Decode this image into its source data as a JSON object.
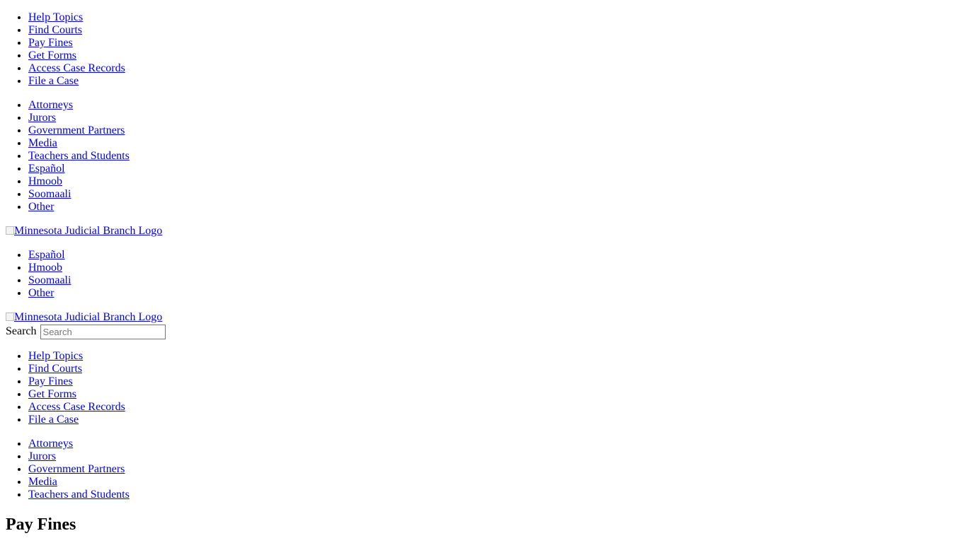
{
  "top_nav": {
    "items": [
      "Help Topics",
      "Find Courts",
      "Pay Fines",
      "Get Forms",
      "Access Case Records",
      "File a Case"
    ]
  },
  "audience_nav": {
    "items": [
      "Attorneys",
      "Jurors",
      "Government Partners",
      "Media",
      "Teachers and Students",
      "Español",
      "Hmoob",
      "Soomaali",
      "Other"
    ]
  },
  "logo": {
    "alt": "Minnesota Judicial Branch Logo"
  },
  "language_nav": {
    "items": [
      "Español",
      "Hmoob",
      "Soomaali",
      "Other"
    ]
  },
  "logo_secondary": {
    "alt": "Minnesota Judicial Branch Logo"
  },
  "search": {
    "label": "Search",
    "placeholder": "Search"
  },
  "main_nav": {
    "items": [
      "Help Topics",
      "Find Courts",
      "Pay Fines",
      "Get Forms",
      "Access Case Records",
      "File a Case"
    ]
  },
  "audience_nav_secondary": {
    "items": [
      "Attorneys",
      "Jurors",
      "Government Partners",
      "Media",
      "Teachers and Students"
    ]
  },
  "page": {
    "title": "Pay Fines"
  }
}
